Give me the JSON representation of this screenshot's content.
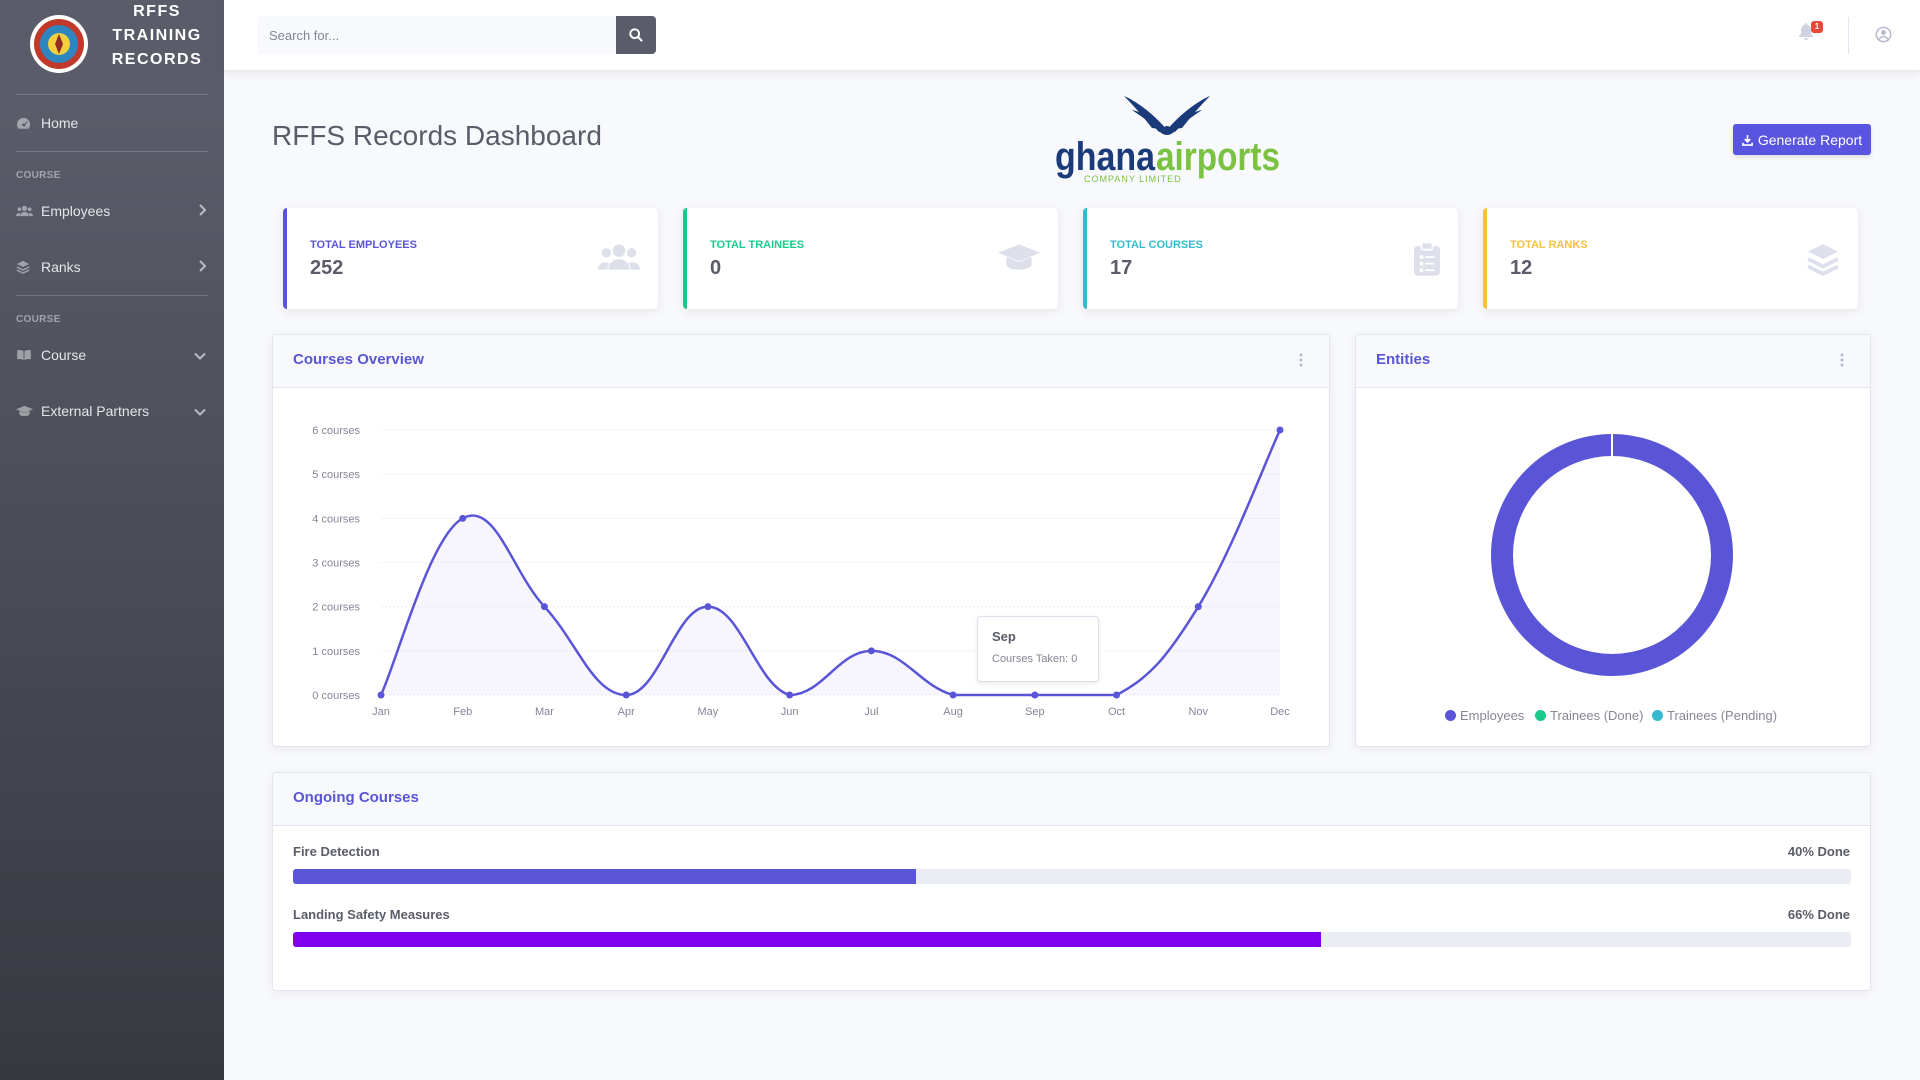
{
  "sidebar": {
    "brand_lines": [
      "RFFS",
      "TRAINING",
      "RECORDS"
    ],
    "home": {
      "label": "Home",
      "icon": "dashboard-icon"
    },
    "heading_1": "COURSE",
    "employees": {
      "label": "Employees",
      "icon": "users-icon"
    },
    "ranks": {
      "label": "Ranks",
      "icon": "layers-icon"
    },
    "heading_2": "COURSE",
    "course": {
      "label": "Course",
      "icon": "book-icon"
    },
    "partners": {
      "label": "External Partners",
      "icon": "graduation-cap-icon"
    }
  },
  "topbar": {
    "search_placeholder": "Search for...",
    "notification_count": "1"
  },
  "page": {
    "title": "RFFS Records Dashboard",
    "report_button": "Generate Report",
    "logo_word_1": "ghana",
    "logo_word_2": "airports",
    "logo_subtitle": "COMPANY LIMITED"
  },
  "stats": [
    {
      "label": "Total Employees",
      "value": "252",
      "color": "#5a55d6",
      "icon": "users-icon"
    },
    {
      "label": "Total Trainees",
      "value": "0",
      "color": "#1cc88a",
      "icon": "graduation-cap-icon"
    },
    {
      "label": "Total Courses",
      "value": "17",
      "color": "#36b9cc",
      "icon": "clipboard-list-icon"
    },
    {
      "label": "Total Ranks",
      "value": "12",
      "color": "#f6c23e",
      "icon": "layers-icon"
    }
  ],
  "overview": {
    "title": "Courses Overview",
    "tooltip_title": "Sep",
    "tooltip_body": "Courses Taken: 0"
  },
  "entities": {
    "title": "Entities",
    "legend": [
      {
        "label": "Employees",
        "color": "#5a55d6"
      },
      {
        "label": "Trainees (Done)",
        "color": "#1cc88a"
      },
      {
        "label": "Trainees (Pending)",
        "color": "#36b9cc"
      }
    ]
  },
  "ongoing": {
    "title": "Ongoing Courses",
    "items": [
      {
        "name": "Fire Detection",
        "pct_label": "40% Done",
        "percent": 40,
        "color": "#5a55d6"
      },
      {
        "name": "Landing Safety Measures",
        "pct_label": "66% Done",
        "percent": 66,
        "color": "#8000ee"
      }
    ]
  },
  "chart_data": [
    {
      "type": "line",
      "title": "Courses Overview",
      "categories": [
        "Jan",
        "Feb",
        "Mar",
        "Apr",
        "May",
        "Jun",
        "Jul",
        "Aug",
        "Sep",
        "Oct",
        "Nov",
        "Dec"
      ],
      "series": [
        {
          "name": "Courses Taken",
          "values": [
            0,
            4,
            2,
            0,
            2,
            0,
            1,
            0,
            0,
            0,
            2,
            6
          ]
        }
      ],
      "y_ticks": [
        "0 courses",
        "1 courses",
        "2 courses",
        "3 courses",
        "4 courses",
        "5 courses",
        "6 courses"
      ],
      "ylim": [
        0,
        6
      ],
      "grid": true,
      "color": "#5a55d6"
    },
    {
      "type": "pie",
      "title": "Entities",
      "categories": [
        "Employees",
        "Trainees (Done)",
        "Trainees (Pending)"
      ],
      "values": [
        252,
        0,
        0
      ],
      "colors": [
        "#5a55d6",
        "#1cc88a",
        "#36b9cc"
      ],
      "legend": "bottom"
    }
  ]
}
